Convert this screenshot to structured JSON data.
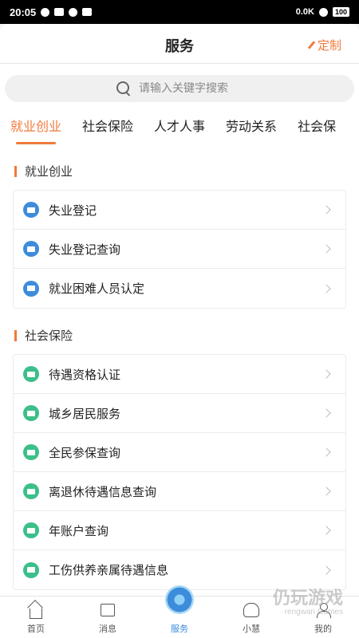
{
  "status_bar": {
    "time": "20:05",
    "network_speed": "0.0K",
    "battery": "100"
  },
  "header": {
    "title": "服务",
    "custom_label": "定制"
  },
  "search": {
    "placeholder": "请输入关键字搜索"
  },
  "tabs": [
    "就业创业",
    "社会保险",
    "人才人事",
    "劳动关系",
    "社会保"
  ],
  "sections": [
    {
      "title": "就业创业",
      "items": [
        {
          "label": "失业登记",
          "icon": "id-card-icon"
        },
        {
          "label": "失业登记查询",
          "icon": "mail-icon"
        },
        {
          "label": "就业困难人员认定",
          "icon": "person-add-icon"
        }
      ]
    },
    {
      "title": "社会保险",
      "items": [
        {
          "label": "待遇资格认证",
          "icon": "mail-icon"
        },
        {
          "label": "城乡居民服务",
          "icon": "mail-icon"
        },
        {
          "label": "全民参保查询",
          "icon": "mail-icon"
        },
        {
          "label": "离退休待遇信息查询",
          "icon": "mail-icon"
        },
        {
          "label": "年账户查询",
          "icon": "mail-icon"
        },
        {
          "label": "工伤供养亲属待遇信息",
          "icon": "mail-icon"
        }
      ]
    }
  ],
  "tabbar": [
    "首页",
    "消息",
    "服务",
    "小慧",
    "我的"
  ],
  "watermark": {
    "main": "仍玩游戏",
    "sub": "rengwan Games"
  },
  "colors": {
    "accent": "#f07a3c",
    "blue": "#3d8cdc",
    "green": "#3cbf8a"
  }
}
